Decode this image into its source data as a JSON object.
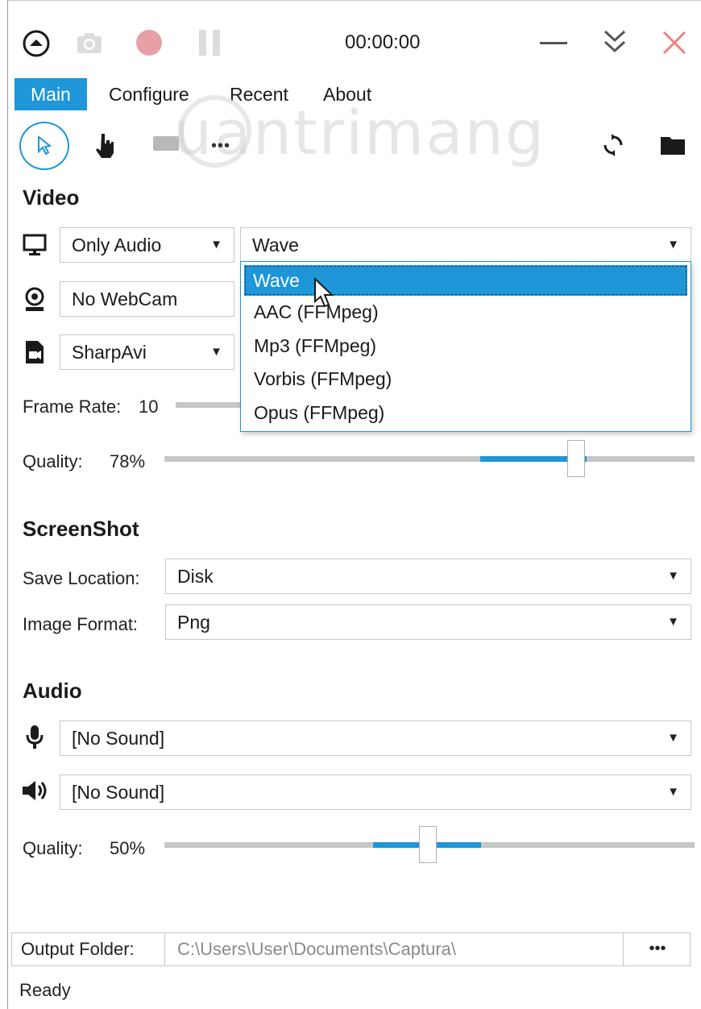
{
  "titlebar": {
    "time": "00:00:00",
    "icons": [
      "collapse-up-icon",
      "camera-icon",
      "record-icon",
      "pause-icon",
      "minimize-icon",
      "chevron-double-down-icon",
      "close-icon"
    ]
  },
  "tabs": [
    {
      "label": "Main",
      "active": true
    },
    {
      "label": "Configure",
      "active": false
    },
    {
      "label": "Recent",
      "active": false
    },
    {
      "label": "About",
      "active": false
    }
  ],
  "toolbar": {
    "icons": [
      "cursor-icon",
      "hand-icon",
      "keyboard-icon",
      "more-dots-icon",
      "refresh-icon",
      "folder-icon"
    ]
  },
  "watermark": "uantrimang",
  "video": {
    "heading": "Video",
    "source": "Only Audio",
    "codec": "Wave",
    "webcam": "No WebCam",
    "encoder": "SharpAvi",
    "frame_rate_label": "Frame Rate:",
    "frame_rate_value": "10",
    "quality_label": "Quality:",
    "quality_value": "78%",
    "quality_fraction": 0.78
  },
  "codec_dropdown": {
    "options": [
      "Wave",
      "AAC (FFMpeg)",
      "Mp3 (FFMpeg)",
      "Vorbis (FFMpeg)",
      "Opus (FFMpeg)"
    ],
    "selected": "Wave"
  },
  "screenshot": {
    "heading": "ScreenShot",
    "save_location_label": "Save Location:",
    "save_location_value": "Disk",
    "image_format_label": "Image Format:",
    "image_format_value": "Png"
  },
  "audio": {
    "heading": "Audio",
    "microphone": "[No Sound]",
    "speaker": "[No Sound]",
    "quality_label": "Quality:",
    "quality_value": "50%",
    "quality_fraction": 0.5
  },
  "output": {
    "label": "Output Folder:",
    "path": "C:\\Users\\User\\Documents\\Captura\\",
    "browse_label": "•••"
  },
  "status": "Ready",
  "colors": {
    "accent": "#1e96d8",
    "record": "#e8a0a8",
    "close": "#f08080"
  }
}
